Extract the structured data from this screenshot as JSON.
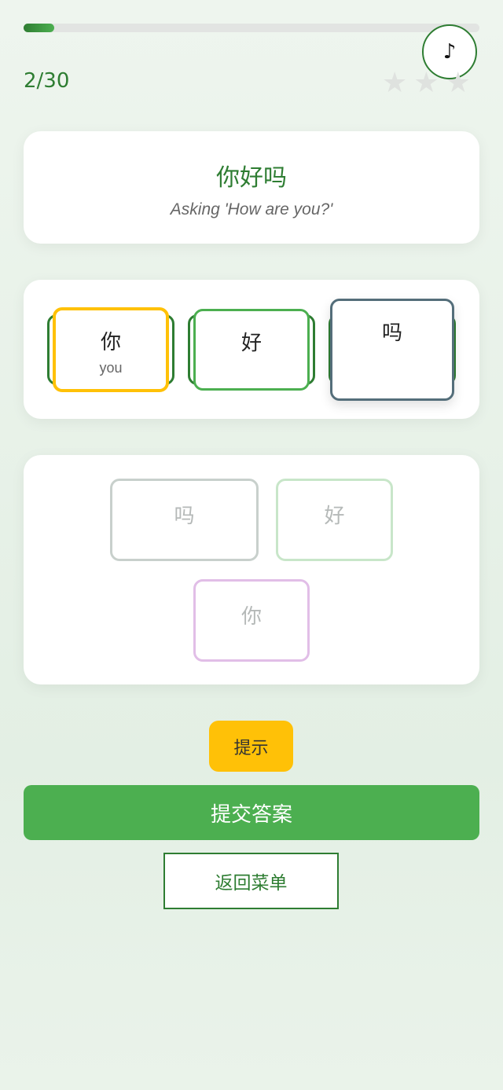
{
  "progress": {
    "current": 2,
    "total": 30,
    "label": "2/30",
    "fraction": 0.0667
  },
  "music": {
    "icon": "music-note-icon",
    "glyph": "♪"
  },
  "stars": {
    "earned": 0,
    "max": 3,
    "glyph": "★",
    "color_empty": "#dfe2df"
  },
  "prompt": {
    "hanzi": "你好吗",
    "meaning": "Asking 'How are you?'"
  },
  "answer_slots": [
    {
      "hanzi": "你",
      "pinyin": "you",
      "state": "selected",
      "border": "#ffc107"
    },
    {
      "hanzi": "好",
      "pinyin": "",
      "state": "placed",
      "border": "#4caf50"
    },
    {
      "hanzi": "吗",
      "pinyin": "",
      "state": "dragging",
      "border": "#546e7a"
    }
  ],
  "word_bank": [
    {
      "hanzi": "吗",
      "border": "#c8d0cc"
    },
    {
      "hanzi": "好",
      "border": "#c8e6c9"
    },
    {
      "hanzi": "你",
      "border": "#e1bee7"
    }
  ],
  "buttons": {
    "hint": "提示",
    "submit": "提交答案",
    "back": "返回菜单"
  },
  "colors": {
    "accent": "#2e7d32",
    "primary": "#4caf50",
    "hint": "#ffc107"
  }
}
